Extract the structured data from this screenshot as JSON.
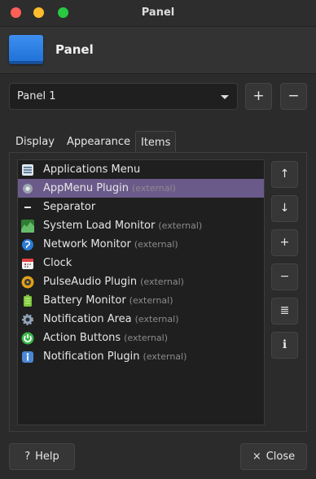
{
  "window": {
    "title": "Panel"
  },
  "header": {
    "title": "Panel"
  },
  "panel_select": {
    "value": "Panel 1",
    "add_label": "+",
    "remove_label": "−"
  },
  "tabs": [
    "Display",
    "Appearance",
    "Items"
  ],
  "active_tab": "Items",
  "items": [
    {
      "name": "Applications Menu",
      "external": "",
      "icon": "menu-icon"
    },
    {
      "name": "AppMenu Plugin",
      "external": "(external)",
      "icon": "appmenu-icon",
      "selected": true
    },
    {
      "name": "Separator",
      "external": "",
      "icon": "separator-icon"
    },
    {
      "name": "System Load Monitor",
      "external": "(external)",
      "icon": "system-load-icon"
    },
    {
      "name": "Network Monitor",
      "external": "(external)",
      "icon": "network-icon"
    },
    {
      "name": "Clock",
      "external": "",
      "icon": "calendar-icon"
    },
    {
      "name": "PulseAudio Plugin",
      "external": "(external)",
      "icon": "speaker-icon"
    },
    {
      "name": "Battery Monitor",
      "external": "(external)",
      "icon": "battery-icon"
    },
    {
      "name": "Notification Area",
      "external": "(external)",
      "icon": "gear-icon"
    },
    {
      "name": "Action Buttons",
      "external": "(external)",
      "icon": "power-icon"
    },
    {
      "name": "Notification Plugin",
      "external": "(external)",
      "icon": "info-icon"
    }
  ],
  "side_buttons": [
    {
      "name": "move-up-button",
      "glyph": "↑"
    },
    {
      "name": "move-down-button",
      "glyph": "↓"
    },
    {
      "name": "add-item-button",
      "glyph": "+"
    },
    {
      "name": "remove-item-button",
      "glyph": "−"
    },
    {
      "name": "list-button",
      "glyph": "≣"
    },
    {
      "name": "about-button",
      "glyph": "ℹ"
    }
  ],
  "footer": {
    "help_label": "Help",
    "help_glyph": "?",
    "close_label": "Close",
    "close_glyph": "×"
  },
  "colors": {
    "accent_selected": "#6a5a8a",
    "background": "#2b2b2b"
  }
}
